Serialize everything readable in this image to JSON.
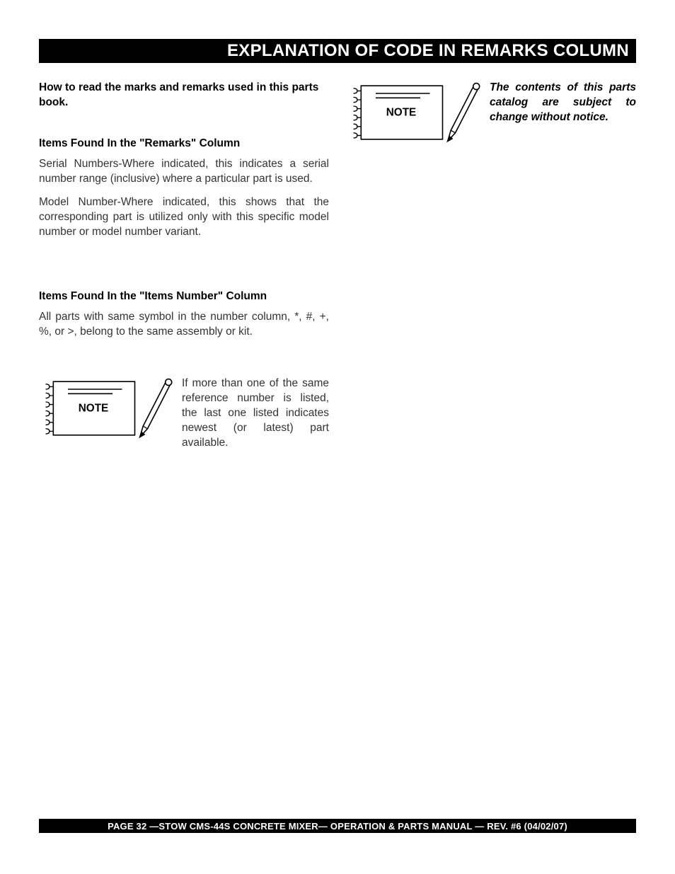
{
  "header": {
    "title": "EXPLANATION OF CODE IN REMARKS COLUMN"
  },
  "left": {
    "intro": "How to read the marks and remarks used in this parts book.",
    "section1_heading": "Items Found In the \"Remarks\" Column",
    "section1_p1": "Serial Numbers-Where indicated, this indicates a serial number range (inclusive) where a particular part is used.",
    "section1_p2": "Model Number-Where indicated, this shows that the corresponding part is utilized only with this specific model number or model number variant.",
    "section2_heading": "Items Found In the \"Items Number\" Column",
    "section2_p1": "All parts with same symbol in the number column, *, #, +, %, or >, belong to the same assembly or kit.",
    "note1_text": "If more than one of the same reference number is listed, the last one listed indicates newest (or latest) part available."
  },
  "right": {
    "note2_text": "The contents of this parts catalog are subject to change without notice."
  },
  "note_label": "NOTE",
  "footer": {
    "text": "PAGE 32 —STOW CMS-44S   CONCRETE MIXER— OPERATION & PARTS MANUAL — REV. #6 (04/02/07)"
  }
}
